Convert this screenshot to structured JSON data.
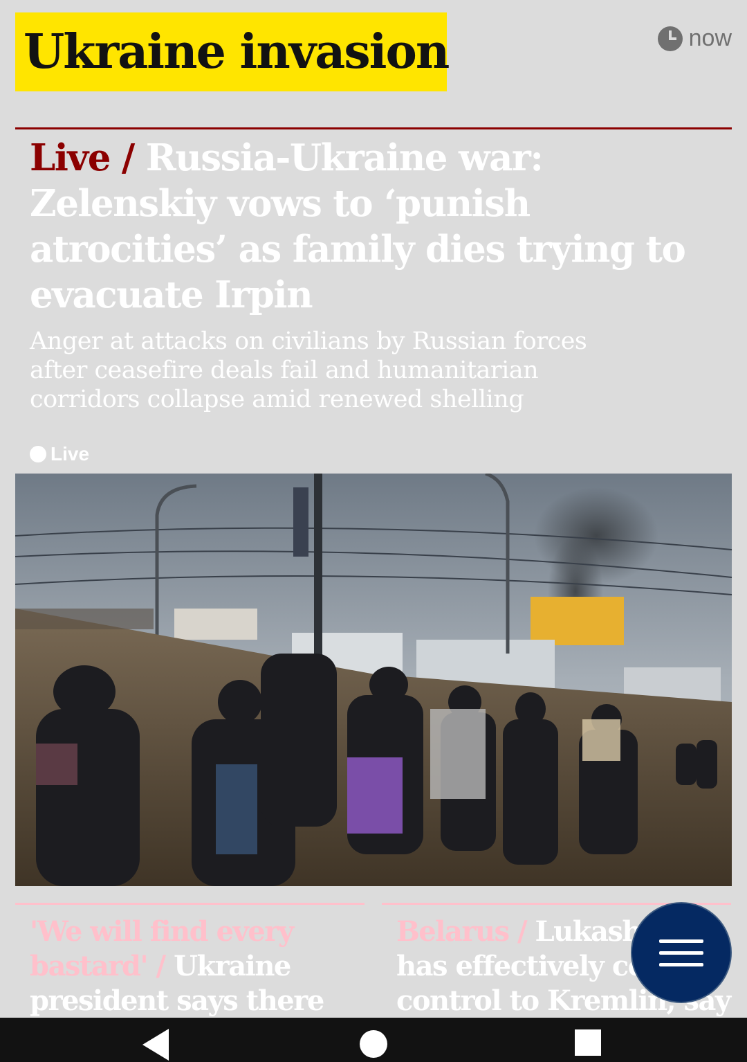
{
  "section": {
    "label": "Ukraine invasion"
  },
  "timestamp": {
    "label": "now",
    "icon": "clock-icon"
  },
  "article": {
    "kicker": "Live /",
    "headline": "Russia-Ukraine war: Zelenskiy vows to ‘punish atrocities’ as family dies trying to evacuate Irpin",
    "standfirst": "Anger at attacks on civilians by Russian forces after ceasefire deals fail and humanitarian corridors collapse amid renewed shelling",
    "live_label": "Live",
    "image_alt": "Civilians carrying bags walk through dry grass beside a highway while smoke rises in the distance"
  },
  "cards": [
    {
      "kicker": "'We will find every bastard' /",
      "title": "Ukraine president says there"
    },
    {
      "kicker": "Belarus /",
      "title": "Lukashenko has effectively ceded control to Kremlin, say"
    }
  ],
  "menu_button": {
    "icon": "menu-icon"
  },
  "nav": {
    "back": "back-icon",
    "home": "home-icon",
    "recents": "recents-icon"
  },
  "colors": {
    "section_yellow": "#ffe500",
    "live_red": "#8b0000",
    "card_pink": "#ffc0cb",
    "fab_navy": "#052962",
    "background": "#dcdcdc"
  }
}
